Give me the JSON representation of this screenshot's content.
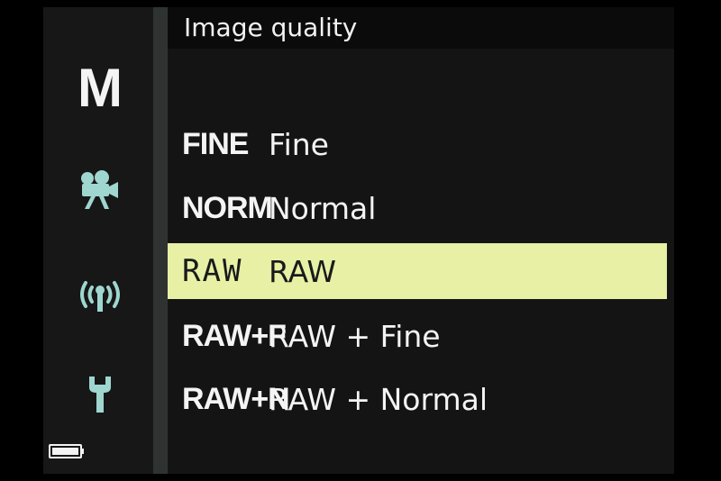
{
  "title": "Image quality",
  "sidebar": {
    "mode": "M",
    "icons": [
      "movie-camera-icon",
      "wireless-icon",
      "wrench-icon",
      "battery-icon"
    ]
  },
  "options": [
    {
      "code": "FINE",
      "label": "Fine",
      "selected": false
    },
    {
      "code": "NORM",
      "label": "Normal",
      "selected": false
    },
    {
      "code": "RAW",
      "label": "RAW",
      "selected": true
    },
    {
      "code": "RAW+F",
      "label": "RAW + Fine",
      "selected": false
    },
    {
      "code": "RAW+N",
      "label": "RAW + Normal",
      "selected": false
    }
  ],
  "colors": {
    "background": "#141414",
    "selected_highlight": "#e7f0a4",
    "text": "#f4f4f4",
    "icon_accent": "#9fd6d0"
  }
}
